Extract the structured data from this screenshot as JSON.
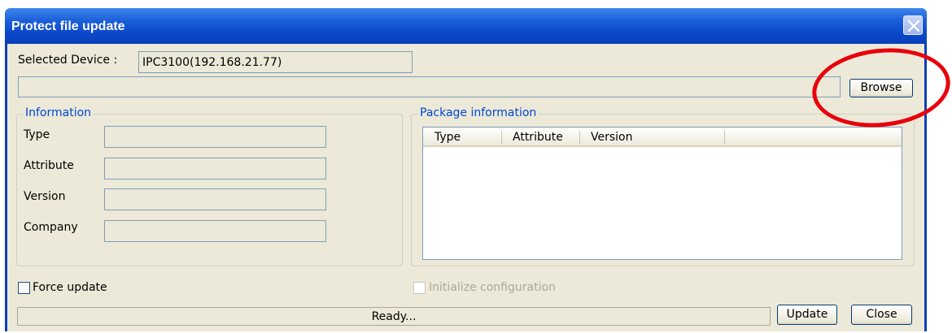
{
  "window": {
    "title": "Protect file update",
    "close_icon": "close-icon"
  },
  "device": {
    "label": "Selected Device :",
    "value": "IPC3100(192.168.21.77)"
  },
  "file": {
    "path": "",
    "browse_label": "Browse"
  },
  "information": {
    "legend": "Information",
    "rows": [
      {
        "label": "Type",
        "value": ""
      },
      {
        "label": "Attribute",
        "value": ""
      },
      {
        "label": "Version",
        "value": ""
      },
      {
        "label": "Company",
        "value": ""
      }
    ]
  },
  "package": {
    "legend": "Package information",
    "columns": [
      "Type",
      "Attribute",
      "Version"
    ]
  },
  "options": {
    "force_update": "Force update",
    "init_config": "Initialize configuration"
  },
  "status": {
    "text": "Ready...",
    "update_label": "Update",
    "close_label": "Close"
  },
  "annotation_color": "#e8000b"
}
